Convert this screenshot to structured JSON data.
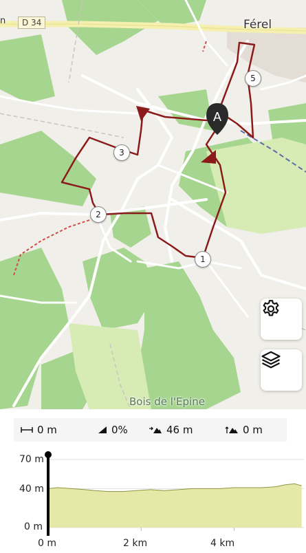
{
  "map": {
    "town_label": "Férel",
    "road_badge": "D 34",
    "edge_label": "n",
    "wood_label": "Bois de l'Epine",
    "start_marker": "A",
    "waypoints": [
      "1",
      "2",
      "3",
      "5"
    ]
  },
  "buttons": {
    "settings_icon": "gear-icon",
    "layers_icon": "layers-icon"
  },
  "stats": {
    "distance": "0 m",
    "grade": "0%",
    "ascent": "46 m",
    "descent": "0 m"
  },
  "elevation_chart": {
    "y_ticks": [
      "70 m",
      "40 m",
      "0 m"
    ],
    "x_ticks": [
      "0 m",
      "2 km",
      "4 km"
    ],
    "fill_color": "#e6e8a8",
    "line_color": "#8f9440"
  },
  "chart_data": {
    "type": "area",
    "xlabel": "",
    "ylabel": "",
    "x_unit": "km",
    "y_unit": "m",
    "ylim": [
      0,
      70
    ],
    "xlim": [
      0,
      5.5
    ],
    "series": [
      {
        "x": [
          0,
          0.2,
          0.5,
          0.8,
          1.0,
          1.3,
          1.6,
          1.9,
          2.2,
          2.5,
          2.8,
          3.1,
          3.4,
          3.7,
          4.0,
          4.3,
          4.6,
          4.9,
          5.1,
          5.3,
          5.45
        ],
        "values": [
          40,
          41,
          40,
          39,
          38,
          37,
          37,
          38,
          39,
          38,
          39,
          40,
          40,
          40,
          41,
          41,
          41,
          42,
          44,
          45,
          43
        ]
      }
    ],
    "current_position_km": 0
  }
}
